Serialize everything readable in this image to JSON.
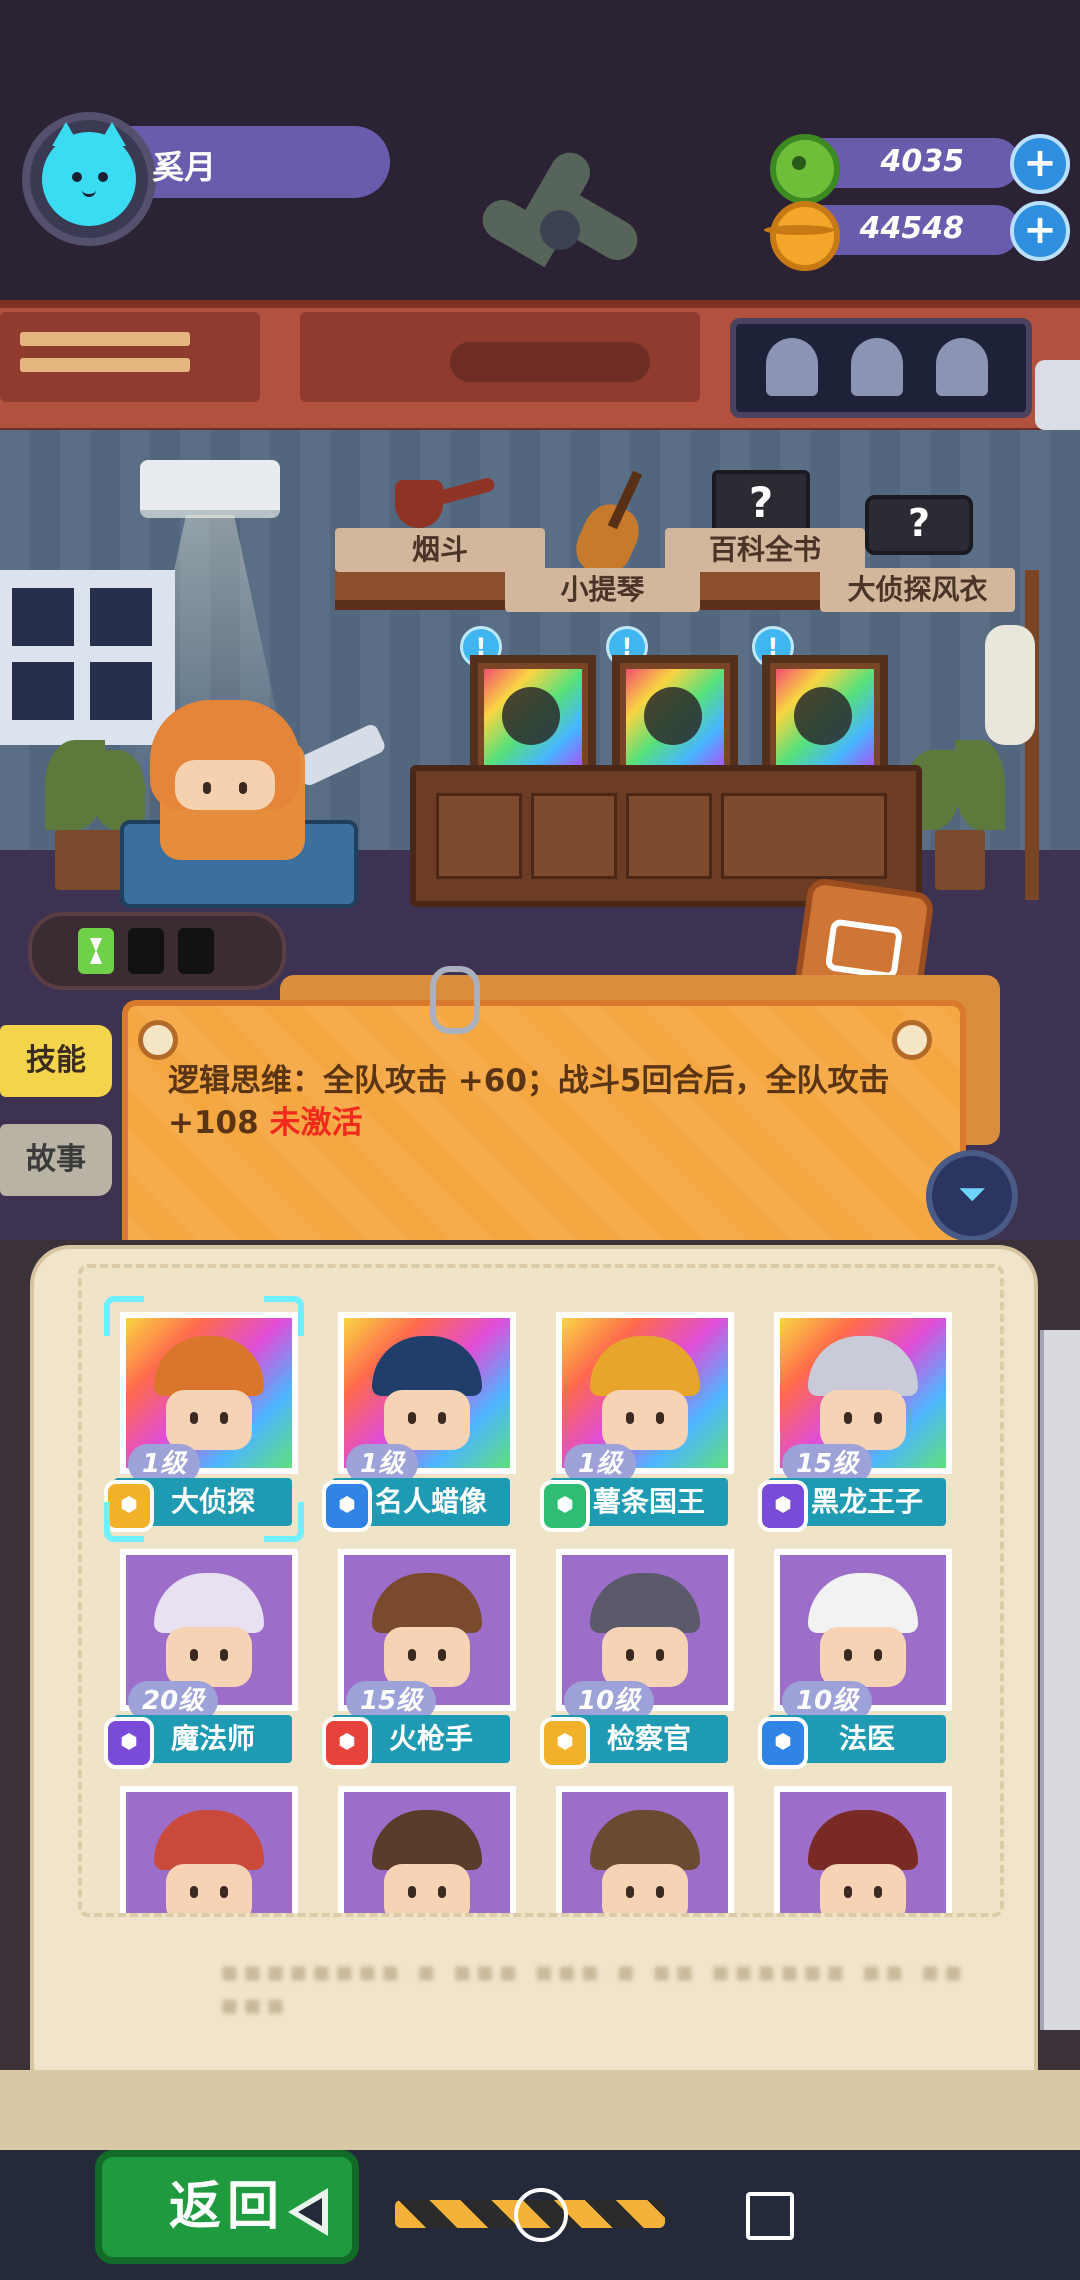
{
  "player": {
    "name": "奚月",
    "avatar_icon": "cat-avatar-icon"
  },
  "resources": [
    {
      "name": "donut",
      "value": "4035",
      "icon": "green-donut-icon",
      "color": "#6fbe3a"
    },
    {
      "name": "planet",
      "value": "44548",
      "icon": "orange-planet-icon",
      "color": "#f4a62a"
    }
  ],
  "collectibles": [
    {
      "label": "烟斗",
      "icon": "pipe-icon",
      "known": true
    },
    {
      "label": "小提琴",
      "icon": "violin-icon",
      "known": true
    },
    {
      "label": "百科全书",
      "icon": "question-book-icon",
      "known": false,
      "glyph": "?"
    },
    {
      "label": "大侦探风衣",
      "icon": "question-coat-icon",
      "known": false,
      "glyph": "?"
    }
  ],
  "side_tabs": {
    "skill": "技能",
    "story": "故事"
  },
  "skill": {
    "text": "逻辑思维：全队攻击 +60；战斗5回合后，全队攻击 +108",
    "status": "未激活"
  },
  "characters": [
    {
      "level": "1级",
      "name": "大侦探",
      "badge": "b-gold",
      "bg": "rainbow",
      "hat": "#d9762c",
      "selected": true
    },
    {
      "level": "1级",
      "name": "名人蜡像",
      "badge": "b-blue",
      "bg": "rainbow",
      "hat": "#1f3f6a"
    },
    {
      "level": "1级",
      "name": "薯条国王",
      "badge": "b-green",
      "bg": "rainbow",
      "hat": "#e7a52c"
    },
    {
      "level": "15级",
      "name": "黑龙王子",
      "badge": "b-purple",
      "bg": "rainbow",
      "hat": "#c9ccd8"
    },
    {
      "level": "20级",
      "name": "魔法师",
      "badge": "b-purple",
      "bg": "purple",
      "hat": "#e7e1f2"
    },
    {
      "level": "15级",
      "name": "火枪手",
      "badge": "b-red",
      "bg": "purple",
      "hat": "#7a4a2c"
    },
    {
      "level": "10级",
      "name": "检察官",
      "badge": "b-gold",
      "bg": "purple",
      "hat": "#5a5a6a"
    },
    {
      "level": "10级",
      "name": "法医",
      "badge": "b-blue",
      "bg": "purple",
      "hat": "#f2f2f2"
    },
    {
      "level": "",
      "name": "",
      "badge": "",
      "bg": "purple",
      "hat": "#c94a3a"
    },
    {
      "level": "",
      "name": "",
      "badge": "",
      "bg": "purple",
      "hat": "#5a3c2a"
    },
    {
      "level": "",
      "name": "",
      "badge": "",
      "bg": "purple",
      "hat": "#6b4a32"
    },
    {
      "level": "",
      "name": "",
      "badge": "",
      "bg": "purple",
      "hat": "#7a2a24"
    }
  ],
  "buttons": {
    "back": "返回",
    "add_glyph": "+",
    "filter_glyph": "⏷"
  }
}
